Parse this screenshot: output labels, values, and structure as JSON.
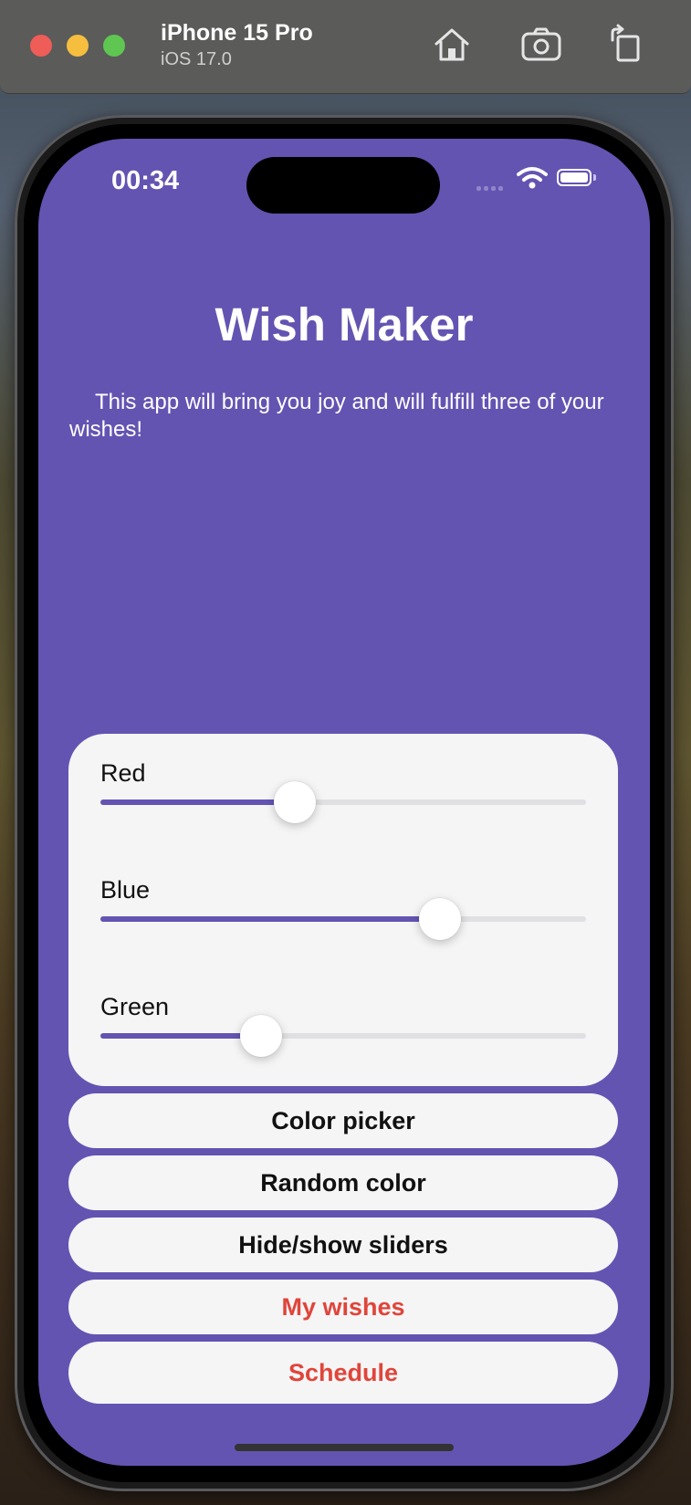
{
  "simulator": {
    "device_name": "iPhone 15 Pro",
    "os_version": "iOS 17.0",
    "icons": [
      "home-icon",
      "screenshot-camera-icon",
      "rotate-icon"
    ]
  },
  "status_bar": {
    "time": "00:34",
    "icons": [
      "cellular-signal-icon",
      "wifi-icon",
      "battery-icon"
    ]
  },
  "app": {
    "title": "Wish Maker",
    "subtitle": "This app will bring you joy and will fulfill three of your wishes!",
    "background_color": "#6354b2"
  },
  "sliders": [
    {
      "label": "Red",
      "value": 0.4
    },
    {
      "label": "Blue",
      "value": 0.7
    },
    {
      "label": "Green",
      "value": 0.33
    }
  ],
  "buttons": {
    "color_picker": "Color picker",
    "random_color": "Random color",
    "hide_show_sliders": "Hide/show sliders",
    "my_wishes": "My wishes",
    "schedule": "Schedule"
  },
  "colors": {
    "accent": "#6354b2",
    "destructive_text": "#e0453a",
    "card_background": "#f5f5f6"
  }
}
